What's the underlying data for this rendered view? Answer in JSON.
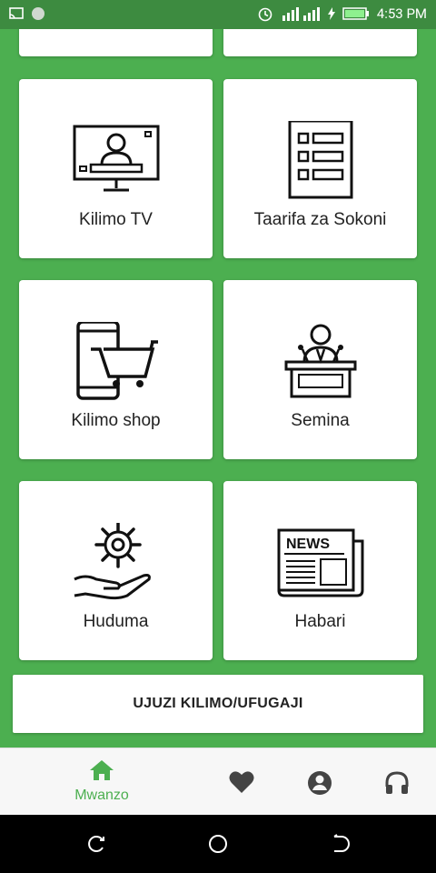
{
  "status_bar": {
    "time": "4:53 PM"
  },
  "tiles": [
    {
      "label": "Kilimo TV",
      "icon": "tv-person-icon"
    },
    {
      "label": "Taarifa za Sokoni",
      "icon": "market-list-icon"
    },
    {
      "label": "Kilimo shop",
      "icon": "mobile-cart-icon"
    },
    {
      "label": "Semina",
      "icon": "speaker-podium-icon"
    },
    {
      "label": "Huduma",
      "icon": "gear-hand-icon"
    },
    {
      "label": "Habari",
      "icon": "newspaper-icon"
    }
  ],
  "newspaper_icon_text": "NEWS",
  "wide_button": {
    "label": "UJUZI KILIMO/UFUGAJI"
  },
  "bottom_nav": {
    "home_label": "Mwanzo",
    "active_color": "#4caf50",
    "items": [
      "home-icon",
      "heart-icon",
      "profile-icon",
      "headphones-icon"
    ]
  },
  "colors": {
    "background": "#4caf50",
    "status_bar": "#3d8b40",
    "card": "#ffffff"
  }
}
